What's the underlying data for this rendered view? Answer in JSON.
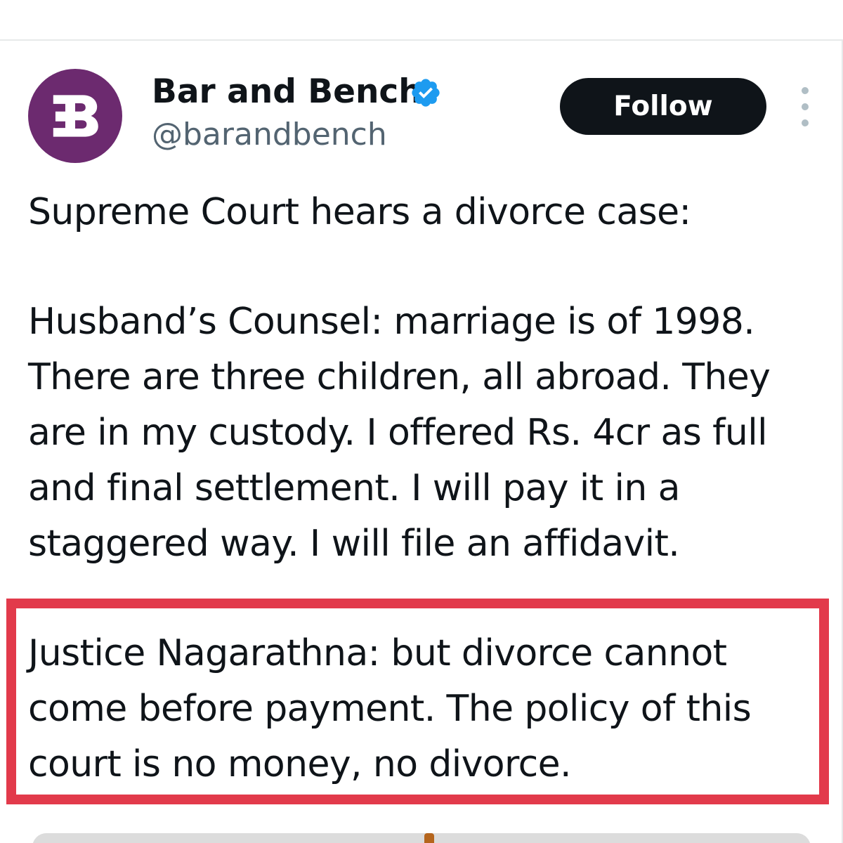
{
  "tweet": {
    "author": {
      "display_name": "Bar and Bench",
      "handle": "@barandbench",
      "verified": true,
      "avatar_icon": "bar-and-bench-logo-icon",
      "avatar_color": "#6c2a6f"
    },
    "follow_label": "Follow",
    "more_icon": "more-vertical-icon",
    "paragraphs": [
      "Supreme Court hears a divorce case:",
      "Husband’s Counsel: marriage is of 1998. There are three children, all abroad. They are in my custody. I offered Rs. 4cr as full and final settlement. I will pay it in a staggered way. I will file an affidavit.",
      "Justice Nagarathna: but divorce cannot come before payment. The policy of this court is no money, no divorce."
    ]
  },
  "colors": {
    "highlight": "#e23a4b",
    "verified_badge": "#1d9bf0",
    "follow_button_bg": "#0f1419",
    "secondary_text": "#536471"
  }
}
